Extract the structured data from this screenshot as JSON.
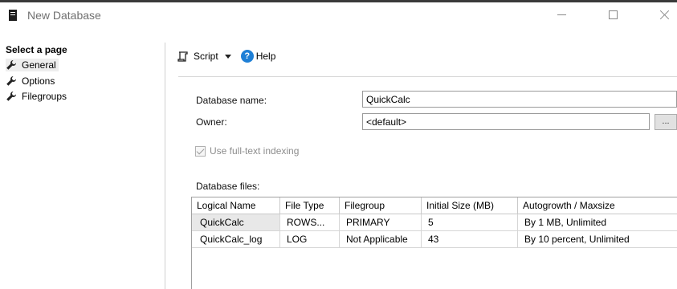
{
  "window": {
    "title": "New Database"
  },
  "sidebar": {
    "header": "Select a page",
    "items": [
      {
        "label": "General",
        "selected": true
      },
      {
        "label": "Options",
        "selected": false
      },
      {
        "label": "Filegroups",
        "selected": false
      }
    ]
  },
  "toolbar": {
    "script_label": "Script",
    "help_label": "Help",
    "help_glyph": "?"
  },
  "form": {
    "database_name_label": "Database name:",
    "database_name_value": "QuickCalc",
    "owner_label": "Owner:",
    "owner_value": "<default>",
    "browse_label": "...",
    "fulltext_label": "Use full-text indexing",
    "fulltext_checked": true,
    "database_files_label": "Database files:"
  },
  "files_table": {
    "columns": [
      "Logical Name",
      "File Type",
      "Filegroup",
      "Initial Size (MB)",
      "Autogrowth / Maxsize"
    ],
    "rows": [
      [
        "QuickCalc",
        "ROWS...",
        "PRIMARY",
        "5",
        "By 1 MB, Unlimited"
      ],
      [
        "QuickCalc_log",
        "LOG",
        "Not Applicable",
        "43",
        "By 10 percent, Unlimited"
      ]
    ]
  },
  "colors": {
    "help_icon": "#1e7fd6",
    "selected_bg": "#e8e8e8"
  }
}
